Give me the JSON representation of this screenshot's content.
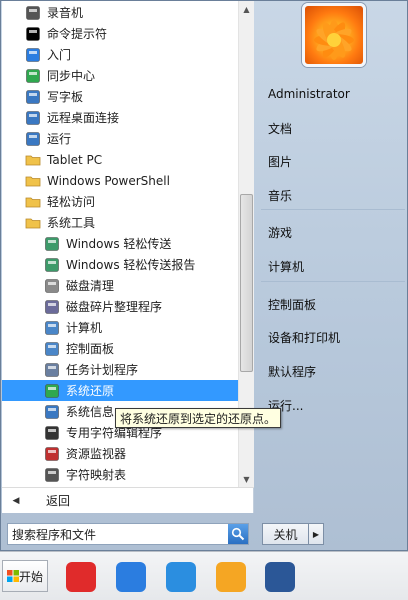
{
  "programs": [
    {
      "label": "录音机",
      "icon": "microphone-icon",
      "level": 0,
      "color": "#555555"
    },
    {
      "label": "命令提示符",
      "icon": "cmd-icon",
      "level": 0,
      "color": "#000000"
    },
    {
      "label": "入门",
      "icon": "getting-started-icon",
      "level": 0,
      "color": "#2a7de1"
    },
    {
      "label": "同步中心",
      "icon": "sync-center-icon",
      "level": 0,
      "color": "#2fa84f"
    },
    {
      "label": "写字板",
      "icon": "wordpad-icon",
      "level": 0,
      "color": "#3a78c2"
    },
    {
      "label": "远程桌面连接",
      "icon": "remote-desktop-icon",
      "level": 0,
      "color": "#3a78c2"
    },
    {
      "label": "运行",
      "icon": "run-icon",
      "level": 0,
      "color": "#3a78c2"
    },
    {
      "label": "Tablet PC",
      "icon": "folder-icon",
      "level": 0,
      "color": "#f0c24a"
    },
    {
      "label": "Windows PowerShell",
      "icon": "folder-icon",
      "level": 0,
      "color": "#f0c24a"
    },
    {
      "label": "轻松访问",
      "icon": "folder-icon",
      "level": 0,
      "color": "#f0c24a"
    },
    {
      "label": "系统工具",
      "icon": "folder-open-icon",
      "level": 0,
      "color": "#f0c24a"
    },
    {
      "label": "Windows 轻松传送",
      "icon": "easy-transfer-icon",
      "level": 1,
      "color": "#3d9a6a"
    },
    {
      "label": "Windows 轻松传送报告",
      "icon": "easy-transfer-icon",
      "level": 1,
      "color": "#3d9a6a"
    },
    {
      "label": "磁盘清理",
      "icon": "disk-cleanup-icon",
      "level": 1,
      "color": "#8a8a8a"
    },
    {
      "label": "磁盘碎片整理程序",
      "icon": "defrag-icon",
      "level": 1,
      "color": "#6b6b9a"
    },
    {
      "label": "计算机",
      "icon": "computer-icon",
      "level": 1,
      "color": "#4a86c8"
    },
    {
      "label": "控制面板",
      "icon": "control-panel-icon",
      "level": 1,
      "color": "#4a86c8"
    },
    {
      "label": "任务计划程序",
      "icon": "task-scheduler-icon",
      "level": 1,
      "color": "#6a7fa0"
    },
    {
      "label": "系统还原",
      "icon": "system-restore-icon",
      "level": 1,
      "color": "#2fa84f",
      "selected": true
    },
    {
      "label": "系统信息",
      "icon": "system-info-icon",
      "level": 1,
      "color": "#3a78c2"
    },
    {
      "label": "专用字符编辑程序",
      "icon": "char-editor-icon",
      "level": 1,
      "color": "#333333"
    },
    {
      "label": "资源监视器",
      "icon": "resource-monitor-icon",
      "level": 1,
      "color": "#c03030"
    },
    {
      "label": "字符映射表",
      "icon": "char-map-icon",
      "level": 1,
      "color": "#555555"
    }
  ],
  "tooltip": "将系统还原到选定的还原点。",
  "back_label": "返回",
  "search": {
    "placeholder": "搜索程序和文件"
  },
  "right_items": [
    {
      "label": "Administrator"
    },
    {
      "label": "文档"
    },
    {
      "label": "图片"
    },
    {
      "label": "音乐"
    },
    {
      "label": "游戏"
    },
    {
      "label": "计算机"
    },
    {
      "label": "控制面板"
    },
    {
      "label": "设备和打印机"
    },
    {
      "label": "默认程序"
    },
    {
      "label": "运行..."
    }
  ],
  "shutdown_label": "关机",
  "taskbar": {
    "start_label": "开始",
    "apps": [
      {
        "icon": "netease-music-icon",
        "color": "#e02b2b"
      },
      {
        "icon": "sogou-input-icon",
        "color": "#2b7de0"
      },
      {
        "icon": "cloud-drive-icon",
        "color": "#2b8ee0"
      },
      {
        "icon": "app-store-icon",
        "color": "#f5a623"
      },
      {
        "icon": "word-icon",
        "color": "#2b5797"
      }
    ]
  }
}
